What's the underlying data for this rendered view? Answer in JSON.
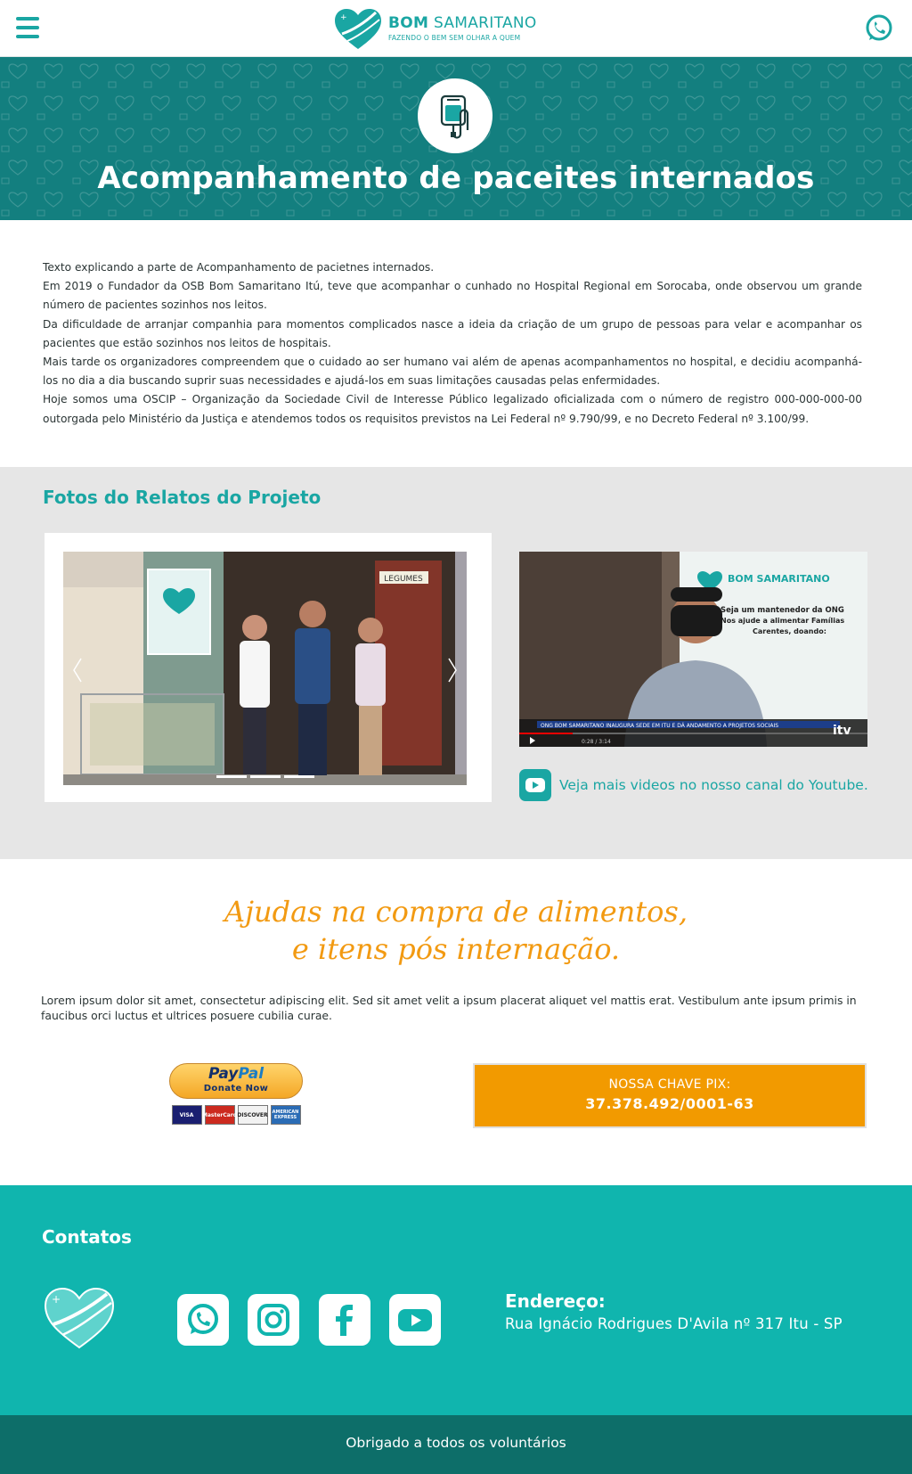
{
  "header": {
    "logo_name_bold": "BOM",
    "logo_name_rest": "SAMARITANO",
    "logo_tagline": "FAZENDO O BEM SEM OLHAR A QUEM",
    "menu_icon": "hamburger-menu-icon",
    "whatsapp_icon": "whatsapp-icon"
  },
  "hero": {
    "title": "Acompanhamento de paceites internados",
    "icon": "iv-drip-icon"
  },
  "intro": {
    "paragraphs": [
      "Texto explicando a parte de Acompanhamento de pacietnes internados.",
      "Em 2019 o Fundador da OSB Bom Samaritano Itú, teve que acompanhar o cunhado no Hospital Regional em Sorocaba, onde observou um grande número de pacientes sozinhos nos leitos.",
      "Da dificuldade de arranjar companhia para momentos complicados nasce a ideia da criação de um grupo de pessoas para velar e acompanhar os pacientes que estão sozinhos nos leitos de hospitais.",
      "Mais tarde os organizadores compreendem que o cuidado ao ser humano vai além de apenas acompanhamentos no hospital, e decidiu acompanhá-los no dia a dia buscando suprir suas necessidades e ajudá-los em suas limitações causadas pelas enfermidades.",
      "Hoje somos uma OSCIP – Organização da Sociedade Civil de Interesse Público legalizado oficializada com o número de registro 000-000-000-00 outorgada pelo Ministério da Justiça e atendemos todos os requisitos previstos na Lei Federal nº 9.790/99, e no Decreto Federal nº 3.100/99."
    ]
  },
  "gallery": {
    "title": "Fotos do Relatos do Projeto",
    "slide_count": 3,
    "active_slide": 1,
    "youtube_link": "Veja mais videos no nosso canal do Youtube.",
    "video_sign": {
      "brand_bold": "BOM",
      "brand_rest": "SAMARITANO",
      "line1": "Seja um mantenedor da ONG",
      "line2": "Nos ajude a alimentar Famílias",
      "line3": "Carentes, doando:"
    },
    "video_caption": "ONG BOM SAMARITANO INAUGURA SEDE EM ITU E DÁ ANDAMENTO A PROJETOS SOCIAIS",
    "video_time": "0:28 / 3:14",
    "video_channel_logo": "itv",
    "slide_sign": "LEGUMES"
  },
  "donation": {
    "title_line1": "Ajudas na compra de alimentos,",
    "title_line2": "e itens pós internação.",
    "text": "Lorem ipsum dolor sit amet, consectetur adipiscing elit. Sed sit amet velit a ipsum placerat aliquet vel mattis erat. Vestibulum ante ipsum primis in faucibus orci luctus et ultrices posuere cubilia curae.",
    "paypal_pay": "Pay",
    "paypal_pal": "Pal",
    "paypal_sub": "Donate Now",
    "cards": [
      "VISA",
      "MasterCard",
      "DISCOVER",
      "AMERICAN EXPRESS"
    ],
    "pix_label": "NOSSA CHAVE PIX:",
    "pix_key": "37.378.492/0001-63"
  },
  "footer": {
    "title": "Contatos",
    "social": [
      "whatsapp-icon",
      "instagram-icon",
      "facebook-icon",
      "youtube-icon"
    ],
    "address_title": "Endereço:",
    "address": "Rua Ignácio Rodrigues D'Avila nº 317 Itu - SP",
    "thanks": "Obrigado a todos os voluntários"
  },
  "colors": {
    "teal": "#1aa6a3",
    "hero_teal": "#137f7f",
    "footer_teal": "#10b5ae",
    "bottom_teal": "#0d6e69",
    "orange": "#f29a12"
  }
}
